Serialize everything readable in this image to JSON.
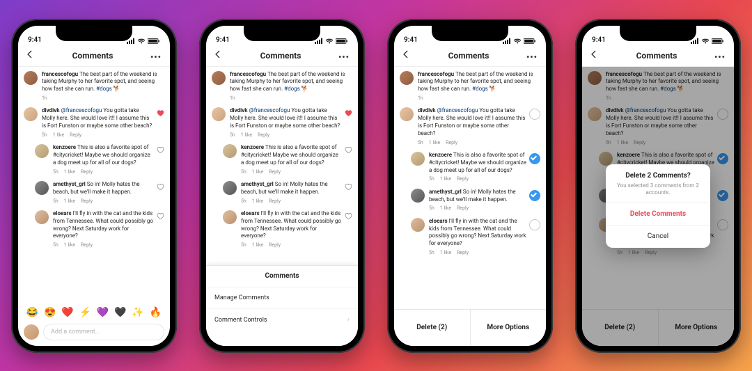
{
  "status": {
    "time": "9:41"
  },
  "header": {
    "title": "Comments"
  },
  "post": {
    "user": "francescofogu",
    "text": "The best part of the weekend is taking Murphy to her favorite spot, and seeing how fast she can run.",
    "hashtag": "#dogs",
    "emoji": "🐕",
    "time": "1h"
  },
  "comments": [
    {
      "user": "divdivk",
      "mention": "@francescofogu",
      "text": "You gotta take Molly here. She would love it!! I assume this is Fort Funston or maybe some other beach?",
      "time": "5h",
      "likes": "1 like",
      "reply": "Reply",
      "liked": true,
      "checked34": false
    },
    {
      "user": "kenzoere",
      "text": "This is also a favorite spot of #citycricket! Maybe we should organize a dog meet up for all of our dogs?",
      "time": "5h",
      "likes": "1 like",
      "reply": "Reply",
      "indent": true,
      "checked34": true
    },
    {
      "user": "amethyst_grl",
      "text": "So in! Molly hates the beach, but we'll make it happen.",
      "time": "5h",
      "likes": "1 like",
      "reply": "Reply",
      "indent": true,
      "checked34": true
    },
    {
      "user": "eloears",
      "text": "I'll fly in with the cat and the kids from Tennessee. What could possibly go wrong? Next Saturday work for everyone?",
      "time": "5h",
      "likes": "1 like",
      "reply": "Reply",
      "indent": true,
      "checked34": false
    }
  ],
  "emojis": [
    "😂",
    "😍",
    "❤️",
    "⚡",
    "💜",
    "🖤",
    "✨",
    "🔥"
  ],
  "input": {
    "placeholder": "Add a comment..."
  },
  "sheet": {
    "title": "Comments",
    "rows": [
      "Manage Comments",
      "Comment Controls"
    ]
  },
  "actionbar": {
    "delete": "Delete (2)",
    "more": "More Options"
  },
  "modal": {
    "title": "Delete 2 Comments?",
    "subtitle": "You selected 3 comments from 2 accounts.",
    "confirm": "Delete Comments",
    "cancel": "Cancel"
  }
}
